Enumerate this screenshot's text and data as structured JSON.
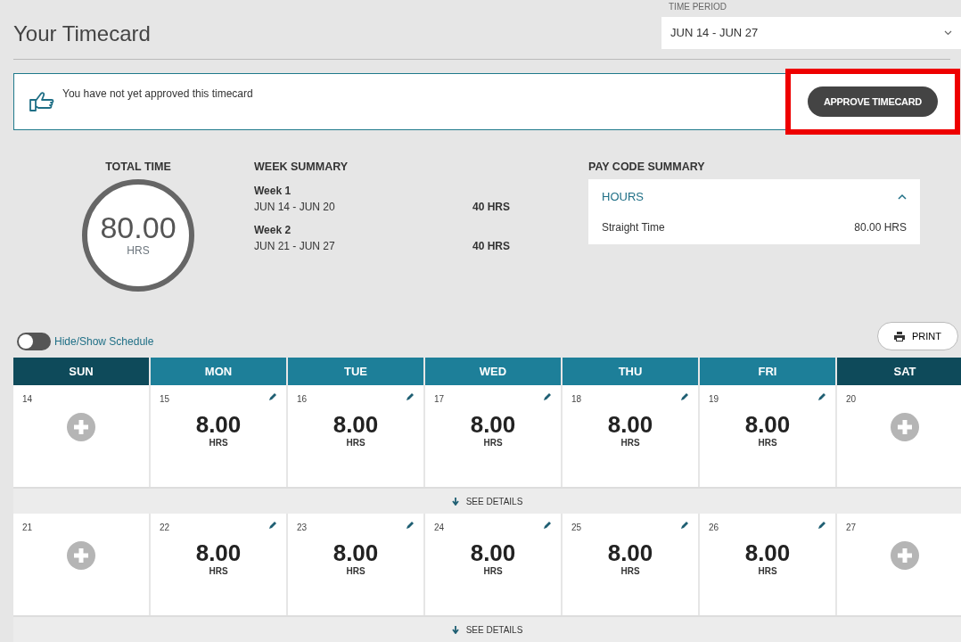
{
  "header": {
    "title": "Your Timecard",
    "time_period": {
      "label": "TIME PERIOD",
      "value": "JUN 14 - JUN 27"
    }
  },
  "notice": {
    "text": "You have not yet approved this timecard",
    "button": "APPROVE TIMECARD",
    "highlighted": true
  },
  "total_time": {
    "label": "TOTAL TIME",
    "value": "80.00",
    "unit": "HRS"
  },
  "week_summary": {
    "title": "WEEK SUMMARY",
    "weeks": [
      {
        "name": "Week 1",
        "range": "JUN 14 - JUN 20",
        "hours": "40 HRS"
      },
      {
        "name": "Week 2",
        "range": "JUN 21 - JUN 27",
        "hours": "40 HRS"
      }
    ]
  },
  "pay_code_summary": {
    "title": "PAY CODE SUMMARY",
    "section": "HOURS",
    "expanded": true,
    "rows": [
      {
        "label": "Straight Time",
        "value": "80.00 HRS"
      }
    ]
  },
  "schedule_toggle": {
    "label": "Hide/Show Schedule",
    "on": false
  },
  "print_button": "PRINT",
  "day_headers": [
    {
      "label": "SUN",
      "weekend": true
    },
    {
      "label": "MON",
      "weekend": false
    },
    {
      "label": "TUE",
      "weekend": false
    },
    {
      "label": "WED",
      "weekend": false
    },
    {
      "label": "THU",
      "weekend": false
    },
    {
      "label": "FRI",
      "weekend": false
    },
    {
      "label": "SAT",
      "weekend": true
    }
  ],
  "weeks": [
    {
      "days": [
        {
          "date": "14",
          "kind": "empty"
        },
        {
          "date": "15",
          "kind": "hours",
          "hours": "8.00",
          "unit": "HRS"
        },
        {
          "date": "16",
          "kind": "hours",
          "hours": "8.00",
          "unit": "HRS"
        },
        {
          "date": "17",
          "kind": "hours",
          "hours": "8.00",
          "unit": "HRS"
        },
        {
          "date": "18",
          "kind": "hours",
          "hours": "8.00",
          "unit": "HRS"
        },
        {
          "date": "19",
          "kind": "hours",
          "hours": "8.00",
          "unit": "HRS"
        },
        {
          "date": "20",
          "kind": "empty"
        }
      ],
      "details": "SEE DETAILS"
    },
    {
      "days": [
        {
          "date": "21",
          "kind": "empty"
        },
        {
          "date": "22",
          "kind": "hours",
          "hours": "8.00",
          "unit": "HRS"
        },
        {
          "date": "23",
          "kind": "hours",
          "hours": "8.00",
          "unit": "HRS"
        },
        {
          "date": "24",
          "kind": "hours",
          "hours": "8.00",
          "unit": "HRS"
        },
        {
          "date": "25",
          "kind": "hours",
          "hours": "8.00",
          "unit": "HRS"
        },
        {
          "date": "26",
          "kind": "hours",
          "hours": "8.00",
          "unit": "HRS"
        },
        {
          "date": "27",
          "kind": "empty"
        }
      ],
      "details": "SEE DETAILS"
    }
  ]
}
